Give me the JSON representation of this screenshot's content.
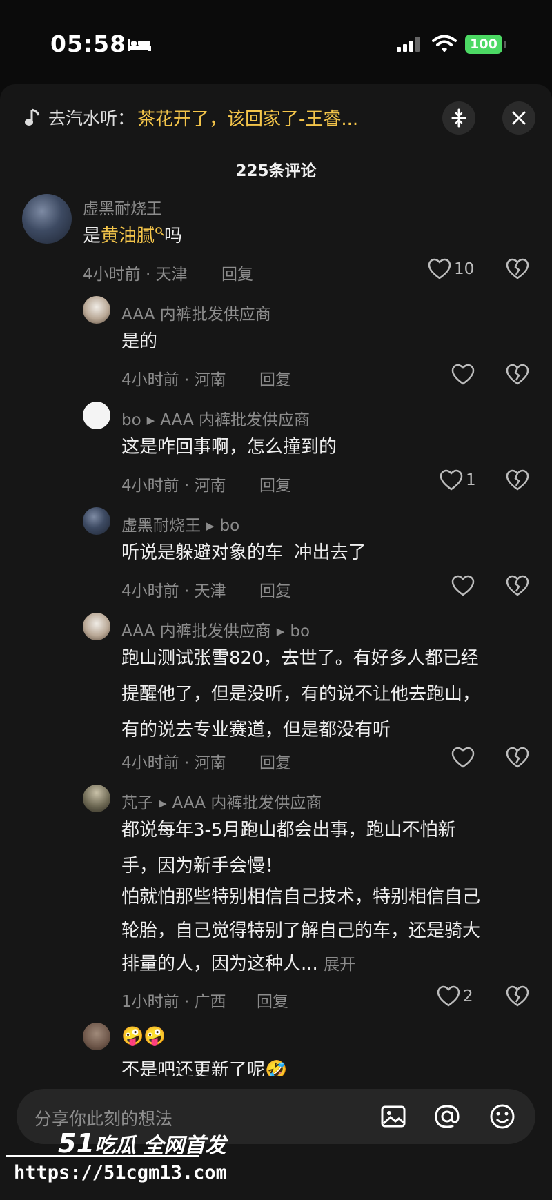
{
  "status": {
    "time": "05:58",
    "battery": "100"
  },
  "music": {
    "prefix": "去汽水听：",
    "title": "茶花开了，该回家了-王睿..."
  },
  "comment_count": "225条评论",
  "comments": [
    {
      "name": "虚黑耐烧王",
      "text_pre": "是",
      "keyword": "黄油腻",
      "text_post": "吗",
      "meta": "4小时前 · 天津",
      "reply": "回复",
      "likes": "10"
    },
    {
      "name": "AAA 内裤批发供应商",
      "text": "是的",
      "meta": "4小时前 · 河南",
      "reply": "回复",
      "likes": ""
    },
    {
      "name": "bo",
      "to": "AAA 内裤批发供应商",
      "text": "这是咋回事啊，怎么撞到的",
      "meta": "4小时前 · 河南",
      "reply": "回复",
      "likes": "1"
    },
    {
      "name": "虚黑耐烧王",
      "to": "bo",
      "text": "听说是躲避对象的车  冲出去了",
      "meta": "4小时前 · 天津",
      "reply": "回复",
      "likes": ""
    },
    {
      "name": "AAA 内裤批发供应商",
      "to": "bo",
      "lines": [
        "跑山测试张雪820，去世了。有好多人都已经",
        "提醒他了，但是没听，有的说不让他去跑山，",
        "有的说去专业赛道，但是都没有听"
      ],
      "meta": "4小时前 · 河南",
      "reply": "回复",
      "likes": ""
    },
    {
      "name": "芃子",
      "to": "AAA 内裤批发供应商",
      "lines": [
        "都说每年3-5月跑山都会出事，跑山不怕新",
        "手，因为新手会慢！",
        "怕就怕那些特别相信自己技术，特别相信自己",
        "轮胎，自己觉得特别了解自己的车，还是骑大",
        "排量的人，因为这种人..."
      ],
      "expand": "展开",
      "meta": "1小时前 · 广西",
      "reply": "回复",
      "likes": "2"
    },
    {
      "name": "",
      "emojis": "🤪🤪",
      "text": "不是吧还更新了呢🤣"
    }
  ],
  "input": {
    "placeholder": "分享你此刻的想法"
  },
  "watermark": {
    "logo_num": "51",
    "logo_text": "吃瓜 全网首发",
    "url": "https://51cgm13.com"
  },
  "icons": [
    "music-note-icon",
    "collapse-icon",
    "close-icon",
    "heart-icon",
    "broken-heart-icon",
    "image-icon",
    "at-icon",
    "emoji-icon",
    "bed-icon",
    "signal-icon",
    "wifi-icon"
  ]
}
